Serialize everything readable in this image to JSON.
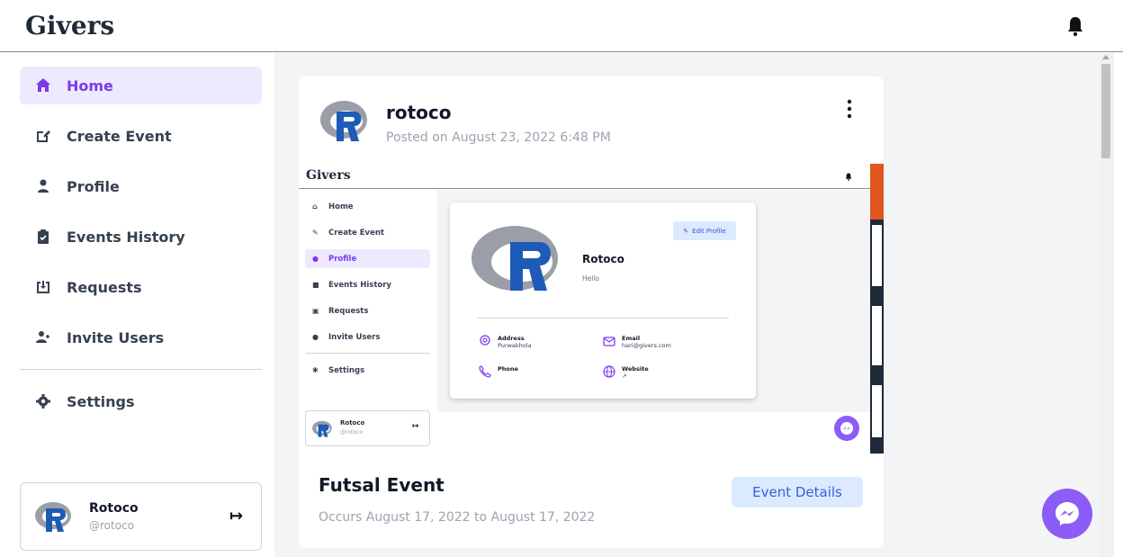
{
  "app": {
    "brand": "Givers"
  },
  "sidebar": {
    "items": [
      {
        "label": "Home",
        "icon": "home-icon",
        "active": true
      },
      {
        "label": "Create Event",
        "icon": "edit-icon",
        "active": false
      },
      {
        "label": "Profile",
        "icon": "user-icon",
        "active": false
      },
      {
        "label": "Events History",
        "icon": "clipboard-check-icon",
        "active": false
      },
      {
        "label": "Requests",
        "icon": "inbox-download-icon",
        "active": false
      },
      {
        "label": "Invite Users",
        "icon": "user-plus-icon",
        "active": false
      }
    ],
    "settings_label": "Settings",
    "user": {
      "name": "Rotoco",
      "handle": "@rotoco"
    }
  },
  "post": {
    "author": "rotoco",
    "posted": "Posted on August 23, 2022 6:48 PM",
    "event_title": "Futsal Event",
    "event_dates": "Occurs August 17, 2022 to August 17, 2022",
    "details_button": "Event Details"
  },
  "embedded": {
    "brand": "Givers",
    "items": [
      {
        "label": "Home",
        "icon": "home-icon",
        "active": false
      },
      {
        "label": "Create Event",
        "icon": "edit-icon",
        "active": false
      },
      {
        "label": "Profile",
        "icon": "user-icon",
        "active": true
      },
      {
        "label": "Events History",
        "icon": "clipboard-check-icon",
        "active": false
      },
      {
        "label": "Requests",
        "icon": "inbox-download-icon",
        "active": false
      },
      {
        "label": "Invite Users",
        "icon": "user-plus-icon",
        "active": false
      }
    ],
    "settings_label": "Settings",
    "user": {
      "name": "Rotoco",
      "handle": "@rotoco"
    },
    "profile": {
      "name": "Rotoco",
      "bio": "Hello",
      "edit_label": "Edit Profile",
      "address_label": "Address",
      "address_value": "Purwakhola",
      "email_label": "Email",
      "email_value": "hari@givers.com",
      "phone_label": "Phone",
      "website_label": "Website"
    }
  },
  "colors": {
    "accent": "#7c3aed",
    "accent_bg": "#ede9fe",
    "button_bg": "#dbeafe",
    "messenger": "#8b5cf6",
    "r_logo_blue": "#1e5bb8",
    "r_logo_gray": "#9a9ea6"
  }
}
